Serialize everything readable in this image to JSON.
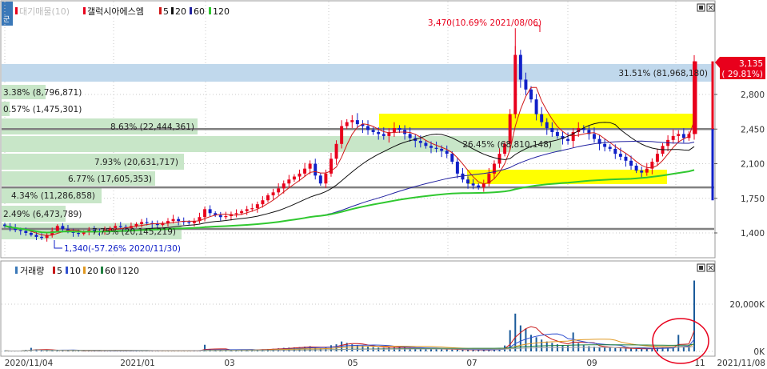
{
  "colors": {
    "up": "#e8001c",
    "down": "#1020c8",
    "ma5": "#d01818",
    "ma20": "#101010",
    "ma60": "#2020a0",
    "ma120": "#30c830",
    "vol_ma5": "#c81818",
    "vol_ma10": "#3050d0",
    "vol_ma20": "#e09820",
    "vol_ma60": "#208040",
    "vol_ma120": "#a0a0a0",
    "band": "#c8e6c8",
    "highlight": "#ffff00",
    "blue_band": "#c0d8ec",
    "grid": "#c8c8c8",
    "hline": "#808080"
  },
  "legend": {
    "price_index_label": "대기매물(10)",
    "stock_name": "갤럭시아에스엠",
    "ma_labels": [
      "5",
      "20",
      "60",
      "120"
    ],
    "volume_title": "거래량",
    "vol_ma_labels": [
      "5",
      "10",
      "20",
      "60",
      "120"
    ]
  },
  "chart_data": [
    {
      "type": "candlestick",
      "title": "갤럭시아에스엠",
      "ylim": [
        1150,
        3700
      ],
      "y_ticks": [
        1400,
        1750,
        2100,
        2450,
        2800
      ],
      "y_tick_labels": [
        "1,400",
        "1,750",
        "2,100",
        "2,450",
        "2,800"
      ],
      "x_tick_labels": [
        "2020/11/04",
        "2021/01",
        "03",
        "05",
        "07",
        "09",
        "11",
        "2021/11/08"
      ],
      "annotations": {
        "high": "3,470(10.69% 2021/08/06)",
        "low": "1,340(-57.26% 2020/11/30)",
        "current_price": "3,135",
        "current_change": "( 29.81%)"
      },
      "volume_profile": [
        {
          "label": "31.51% (81,968,180)"
        },
        {
          "label": "3.38% (8,796,871)"
        },
        {
          "label": "0.57% (1,475,301)"
        },
        {
          "label": "8.63% (22,444,361)"
        },
        {
          "label": "26.45% (68,810,148)"
        },
        {
          "label": "7.93% (20,631,717)"
        },
        {
          "label": "6.77% (17,605,353)"
        },
        {
          "label": "4.34% (11,286,858)"
        },
        {
          "label": "2.49% (6,473,789)"
        },
        {
          "label": "7.75% (20,145,219)"
        }
      ],
      "horizontal_lines": [
        2450,
        1860,
        1440
      ],
      "series": [
        {
          "name": "종가",
          "values": [
            1470,
            1450,
            1430,
            1420,
            1400,
            1380,
            1360,
            1350,
            1380,
            1420,
            1470,
            1440,
            1420,
            1400,
            1390,
            1410,
            1430,
            1420,
            1410,
            1430,
            1450,
            1470,
            1460,
            1450,
            1470,
            1490,
            1510,
            1500,
            1490,
            1480,
            1500,
            1520,
            1540,
            1520,
            1510,
            1500,
            1520,
            1560,
            1640,
            1600,
            1580,
            1560,
            1570,
            1590,
            1600,
            1620,
            1640,
            1650,
            1690,
            1730,
            1780,
            1810,
            1850,
            1900,
            1940,
            1970,
            2000,
            2050,
            2100,
            1980,
            1900,
            2000,
            2150,
            2300,
            2480,
            2520,
            2540,
            2500,
            2480,
            2440,
            2420,
            2400,
            2380,
            2420,
            2460,
            2440,
            2400,
            2360,
            2330,
            2310,
            2280,
            2260,
            2250,
            2230,
            2200,
            2120,
            2000,
            1940,
            1900,
            1880,
            1860,
            1900,
            2000,
            2100,
            2200,
            2300,
            2600,
            3200,
            2950,
            2850,
            2750,
            2600,
            2520,
            2460,
            2420,
            2380,
            2350,
            2330,
            2420,
            2460,
            2440,
            2400,
            2350,
            2300,
            2270,
            2250,
            2200,
            2170,
            2130,
            2080,
            2030,
            2010,
            2050,
            2120,
            2200,
            2280,
            2340,
            2380,
            2400,
            2360,
            2400,
            3135
          ]
        },
        {
          "name": "MA5",
          "values": []
        },
        {
          "name": "MA20",
          "values": []
        },
        {
          "name": "MA60",
          "values": []
        },
        {
          "name": "MA120",
          "values": []
        }
      ]
    },
    {
      "type": "bar",
      "title": "거래량",
      "y_tick_labels": [
        "0K",
        "20,000K"
      ],
      "ylim": [
        0,
        28000
      ],
      "values": [
        200,
        150,
        160,
        180,
        600,
        1500,
        900,
        400,
        300,
        250,
        700,
        400,
        300,
        250,
        220,
        200,
        260,
        240,
        200,
        230,
        260,
        300,
        280,
        250,
        300,
        360,
        350,
        300,
        280,
        260,
        300,
        350,
        380,
        300,
        280,
        260,
        320,
        400,
        2800,
        900,
        600,
        500,
        420,
        500,
        550,
        600,
        650,
        700,
        800,
        900,
        1000,
        1100,
        1300,
        1500,
        1600,
        1700,
        1800,
        2000,
        2200,
        1500,
        1300,
        1800,
        2600,
        3000,
        4200,
        3600,
        3000,
        2600,
        2400,
        2000,
        1800,
        1600,
        1500,
        1700,
        1900,
        1700,
        1500,
        1400,
        1300,
        1200,
        1100,
        1000,
        950,
        900,
        850,
        800,
        700,
        650,
        620,
        600,
        580,
        620,
        700,
        900,
        1400,
        2500,
        9000,
        16000,
        11000,
        9500,
        7000,
        6000,
        5000,
        4200,
        3600,
        3000,
        2600,
        2400,
        8000,
        3500,
        2600,
        2200,
        2000,
        1800,
        1600,
        1500,
        1400,
        1300,
        1200,
        1150,
        1100,
        1050,
        1100,
        1300,
        1500,
        1800,
        2000,
        2200,
        7000,
        2000,
        2500,
        30000
      ]
    }
  ]
}
